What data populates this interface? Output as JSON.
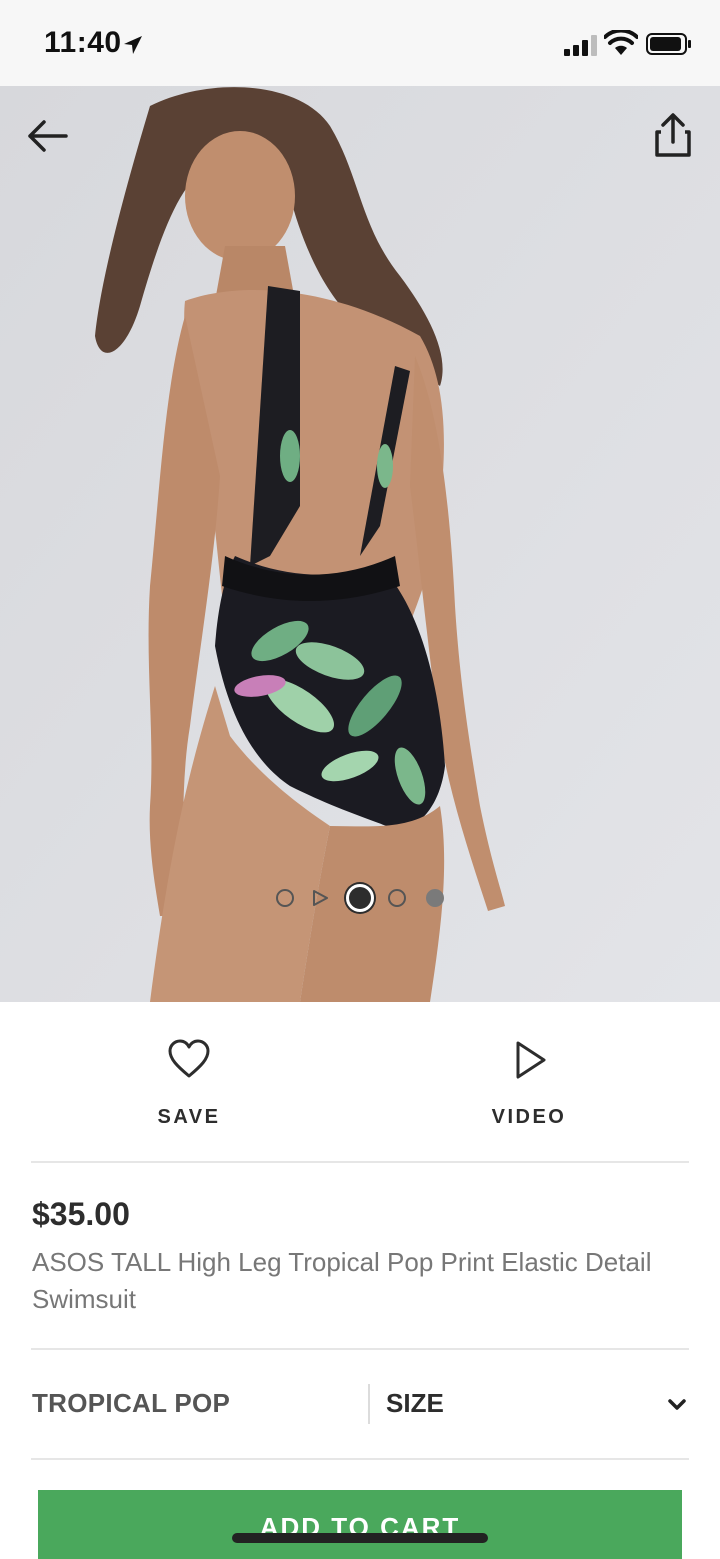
{
  "status_bar": {
    "time": "11:40",
    "icons": [
      "location-arrow-icon",
      "cellular-signal-icon",
      "wifi-icon",
      "battery-icon"
    ]
  },
  "product_gallery": {
    "image_description": "model wearing tropical leaf print high leg swimsuit, back view",
    "page_indicator": {
      "items": [
        "image",
        "video",
        "image",
        "image",
        "image"
      ],
      "active_index": 2
    },
    "icons": {
      "back": "back-arrow-icon",
      "share": "share-icon"
    }
  },
  "actions": {
    "save_label": "SAVE",
    "video_label": "VIDEO"
  },
  "product": {
    "price": "$35.00",
    "title": "ASOS TALL High Leg Tropical Pop Print Elastic Detail Swimsuit"
  },
  "variants": {
    "colour": "TROPICAL POP",
    "size_placeholder": "SIZE"
  },
  "cart": {
    "button_label": "ADD TO CART"
  },
  "colors": {
    "accent_green": "#4aa85c",
    "text_dark": "#2d2d2d",
    "text_muted": "#777777",
    "image_background": "#dcdde1"
  }
}
